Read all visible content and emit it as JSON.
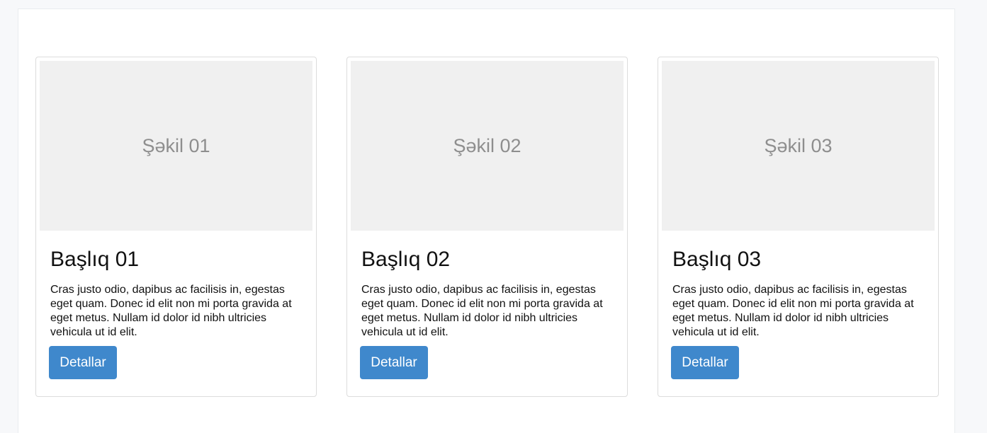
{
  "cards": [
    {
      "image_label": "Şəkil 01",
      "title": "Başlıq 01",
      "text": "Cras justo odio, dapibus ac facilisis in, egestas eget quam. Donec id elit non mi porta gravida at eget metus. Nullam id dolor id nibh ultricies vehicula ut id elit.",
      "button_label": "Detallar"
    },
    {
      "image_label": "Şəkil 02",
      "title": "Başlıq 02",
      "text": "Cras justo odio, dapibus ac facilisis in, egestas eget quam. Donec id elit non mi porta gravida at eget metus. Nullam id dolor id nibh ultricies vehicula ut id elit.",
      "button_label": "Detallar"
    },
    {
      "image_label": "Şəkil 03",
      "title": "Başlıq 03",
      "text": "Cras justo odio, dapibus ac facilisis in, egestas eget quam. Donec id elit non mi porta gravida at eget metus. Nullam id dolor id nibh ultricies vehicula ut id elit.",
      "button_label": "Detallar"
    }
  ],
  "colors": {
    "button_bg": "#3f88cc",
    "placeholder_bg": "#f0f0f0",
    "placeholder_text": "#8e8e8e"
  }
}
